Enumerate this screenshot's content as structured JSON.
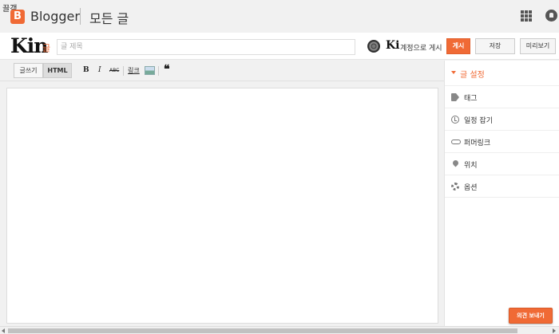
{
  "header": {
    "corner_text": "끌갬",
    "logo_letter": "B",
    "brand": "Blogger",
    "page_title": "모든 글",
    "icons": [
      "apps-grid-icon",
      "notifications-icon"
    ]
  },
  "titlebar": {
    "blog_logo": "Kin",
    "blog_logo_suffix": "글",
    "title_placeholder": "글 제목",
    "account_logo": "Ki",
    "account_post_text": "계정으로 게시",
    "publish_label": "게시",
    "save_label": "저장",
    "preview_label": "미리보기"
  },
  "toolbar": {
    "compose_label": "글쓰기",
    "html_label": "HTML",
    "bold": "B",
    "italic": "I",
    "strike": "ABC",
    "link": "링크",
    "quote": "❝"
  },
  "sidebar": {
    "header": "글 설정",
    "items": [
      {
        "label": "태그",
        "icon": "tag-icon"
      },
      {
        "label": "일정 잡기",
        "icon": "clock-icon"
      },
      {
        "label": "퍼머링크",
        "icon": "link-icon"
      },
      {
        "label": "위치",
        "icon": "location-pin-icon"
      },
      {
        "label": "옵션",
        "icon": "gear-icon"
      }
    ]
  },
  "feedback_label": "의견 보내기",
  "colors": {
    "accent": "#f06a35",
    "background": "#f1f1f1"
  }
}
